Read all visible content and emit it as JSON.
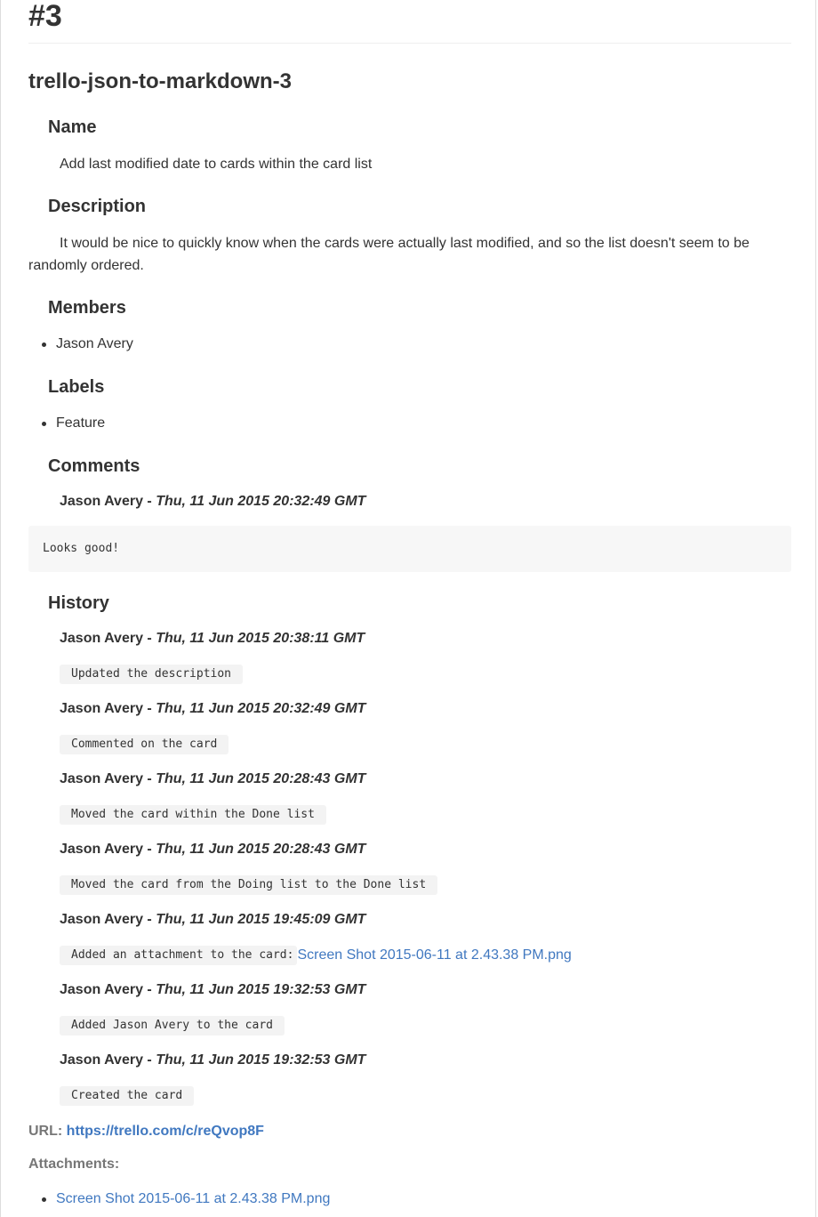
{
  "heading": "#3",
  "card_title": "trello-json-to-markdown-3",
  "sections": {
    "name": {
      "heading": "Name",
      "text": "Add last modified date to cards within the card list"
    },
    "description": {
      "heading": "Description",
      "text": "It would be nice to quickly know when the cards were actually last modified, and so the list doesn't seem to be randomly ordered."
    },
    "members": {
      "heading": "Members",
      "items": [
        "Jason Avery"
      ]
    },
    "labels": {
      "heading": "Labels",
      "items": [
        "Feature"
      ]
    },
    "comments": {
      "heading": "Comments",
      "items": [
        {
          "author": "Jason Avery",
          "separator": " - ",
          "date": "Thu, 11 Jun 2015 20:32:49 GMT",
          "text": "Looks good!"
        }
      ]
    },
    "history": {
      "heading": "History",
      "items": [
        {
          "author": "Jason Avery",
          "separator": " - ",
          "date": "Thu, 11 Jun 2015 20:38:11 GMT",
          "action": "Updated the description"
        },
        {
          "author": "Jason Avery",
          "separator": " - ",
          "date": "Thu, 11 Jun 2015 20:32:49 GMT",
          "action": "Commented on the card"
        },
        {
          "author": "Jason Avery",
          "separator": " - ",
          "date": "Thu, 11 Jun 2015 20:28:43 GMT",
          "action": "Moved the card within the Done list"
        },
        {
          "author": "Jason Avery",
          "separator": " - ",
          "date": "Thu, 11 Jun 2015 20:28:43 GMT",
          "action": "Moved the card from the Doing list to the Done list"
        },
        {
          "author": "Jason Avery",
          "separator": " - ",
          "date": "Thu, 11 Jun 2015 19:45:09 GMT",
          "action": "Added an attachment to the card:",
          "link": "Screen Shot 2015-06-11 at 2.43.38 PM.png"
        },
        {
          "author": "Jason Avery",
          "separator": " - ",
          "date": "Thu, 11 Jun 2015 19:32:53 GMT",
          "action": "Added Jason Avery to the card"
        },
        {
          "author": "Jason Avery",
          "separator": " - ",
          "date": "Thu, 11 Jun 2015 19:32:53 GMT",
          "action": "Created the card"
        }
      ]
    }
  },
  "url": {
    "label": "URL:",
    "link": "https://trello.com/c/reQvop8F"
  },
  "attachments": {
    "label": "Attachments:",
    "items": [
      "Screen Shot 2015-06-11 at 2.43.38 PM.png"
    ]
  },
  "colors": {
    "text": "#333333",
    "link": "#4078c0",
    "muted": "#777777",
    "code_bg": "#f7f7f7"
  }
}
